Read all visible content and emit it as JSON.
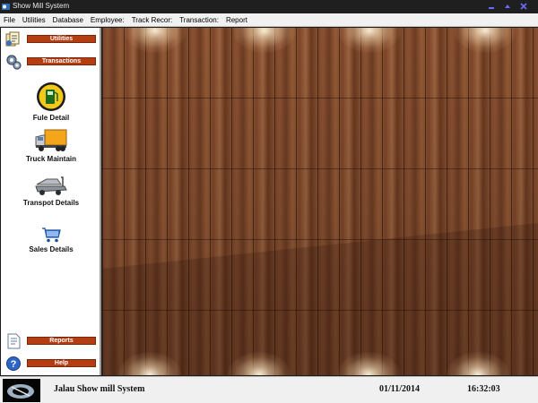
{
  "window": {
    "title": "Show Mill System",
    "buttons": [
      "minimize",
      "maximize",
      "close"
    ]
  },
  "menu": {
    "items": [
      "File",
      "Utilities",
      "Database",
      "Employee:",
      "Track Recor:",
      "Transaction:",
      "Report"
    ]
  },
  "sidebar": {
    "sections": {
      "utilities": "Utilities",
      "transactions": "Transactions",
      "reports": "Reports",
      "help": "Help"
    },
    "items": [
      {
        "label": "Fule Detail",
        "icon": "fuel-pump-icon"
      },
      {
        "label": "Truck Maintain",
        "icon": "truck-icon"
      },
      {
        "label": "Transpot Details",
        "icon": "forklift-icon"
      },
      {
        "label": "Sales Details",
        "icon": "shopping-cart-icon"
      }
    ]
  },
  "status": {
    "system_name": "Jalau Show mill System",
    "date": "01/11/2014",
    "time": "16:32:03"
  },
  "colors": {
    "section_button": "#b43d12",
    "titlebar": "#1f1f1f",
    "window_button_icon": "#6a6aff",
    "wood": "#8a5233"
  }
}
